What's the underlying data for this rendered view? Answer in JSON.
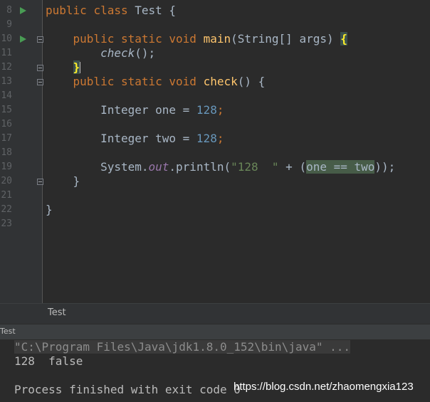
{
  "editor": {
    "line_numbers": [
      "8",
      "9",
      "10",
      "11",
      "12",
      "13",
      "14",
      "15",
      "16",
      "17",
      "18",
      "19",
      "20",
      "21",
      "22",
      "23"
    ],
    "code": {
      "l8": {
        "kw1": "public",
        "kw2": "class",
        "name": " Test {"
      },
      "l10": {
        "kw1": "public",
        "kw2": "static",
        "kw3": "void",
        "fn": "main",
        "params": "(String[] args) ",
        "brace": "{"
      },
      "l11": {
        "call": "check",
        "rest": "();"
      },
      "l12": {
        "brace": "}"
      },
      "l13": {
        "kw1": "public",
        "kw2": "static",
        "kw3": "void",
        "fn": "check",
        "rest": "() {"
      },
      "l15": {
        "type": "Integer one = ",
        "num": "128",
        "semi": ";"
      },
      "l17": {
        "type": "Integer two = ",
        "num": "128",
        "semi": ";"
      },
      "l19": {
        "cls": "System.",
        "field": "out",
        "method": ".println(",
        "str": "\"128  \"",
        "plus": " + (",
        "expr": "one == two",
        "close": "));"
      },
      "l20": {
        "brace": "}"
      },
      "l22": {
        "brace": "}"
      }
    }
  },
  "breadcrumb": {
    "label": "Test"
  },
  "run_panel": {
    "tab_label": "Test"
  },
  "console": {
    "command": "\"C:\\Program Files\\Java\\jdk1.8.0_152\\bin\\java\" ...",
    "output": "128  false",
    "exit": "Process finished with exit code 0"
  },
  "watermark": "https://blog.csdn.net/zhaomengxia123",
  "colors": {
    "background": "#2b2b2b",
    "keyword": "#cc7832",
    "method": "#ffc66d",
    "number": "#6897bb",
    "string": "#6a8759",
    "field": "#9876aa",
    "run_icon": "#499c54"
  }
}
